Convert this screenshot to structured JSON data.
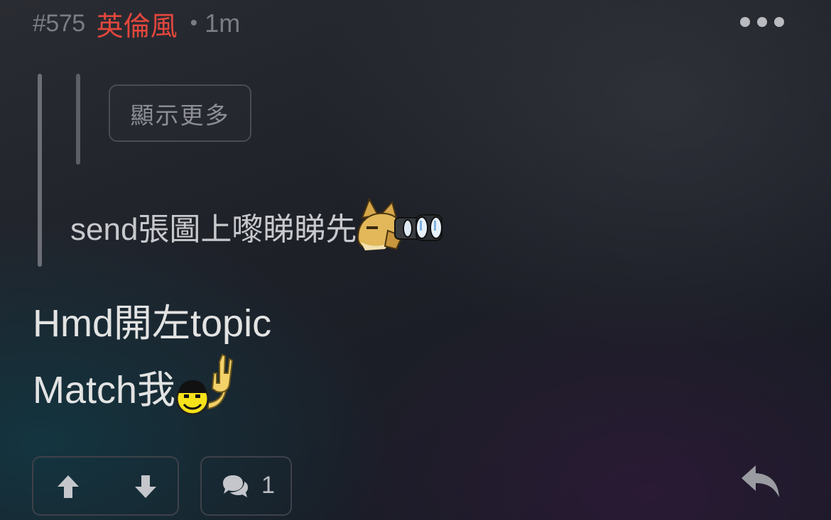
{
  "post": {
    "floor": "#575",
    "username": "英倫風",
    "separator": "•",
    "time": "1m",
    "more_icon": "more-horizontal-icon"
  },
  "quote": {
    "show_more_label": "顯示更多",
    "text": "send張圖上嚟睇睇先",
    "sticker": "binoculars-fox-sticker"
  },
  "body": {
    "line1": "Hmd開左topic",
    "line2": "Match我",
    "line2_sticker": "rock-on-smiley-sticker"
  },
  "actions": {
    "upvote_icon": "arrow-up-icon",
    "downvote_icon": "arrow-down-icon",
    "comment_icon": "comment-bubbles-icon",
    "comment_count": "1",
    "reply_icon": "reply-icon"
  },
  "colors": {
    "username": "#e2473d",
    "meta": "#7b7d84",
    "text": "#e3e3e3",
    "quote_text": "#c8c9cd",
    "border": "#3e414a"
  }
}
